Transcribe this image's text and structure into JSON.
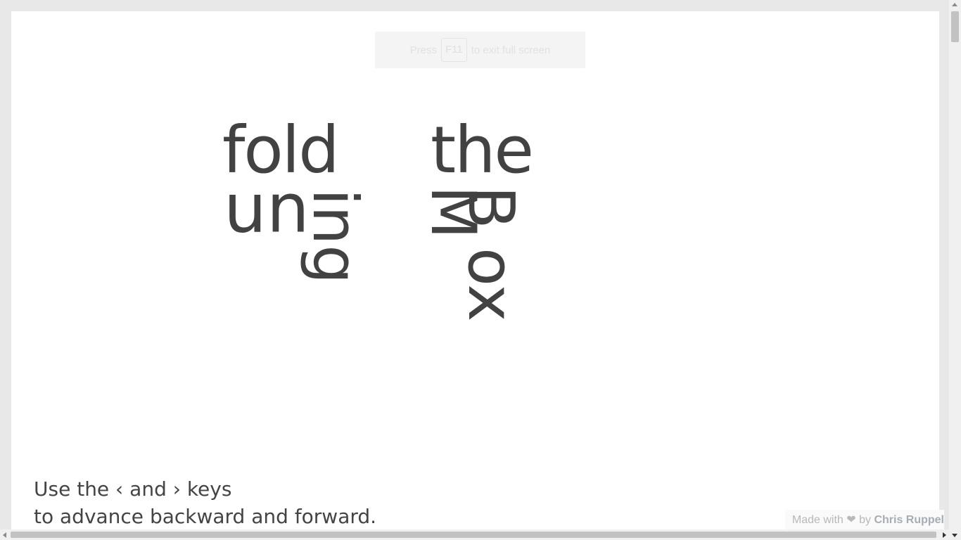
{
  "fullscreen_notice": {
    "prefix": "Press",
    "key": "F11",
    "suffix": "to exit full screen"
  },
  "artwork": {
    "words": {
      "fold": "fold",
      "un": "un",
      "ing": "ing",
      "the": "the",
      "b": "B",
      "w": "M",
      "ox": "ox"
    }
  },
  "instructions": {
    "line1": "Use the ‹ and › keys",
    "line2": "to advance backward and forward."
  },
  "credit": {
    "prefix": "Made with ❤ by",
    "author": "Chris Ruppel"
  },
  "colors": {
    "text": "#424242",
    "background": "#ffffff"
  }
}
